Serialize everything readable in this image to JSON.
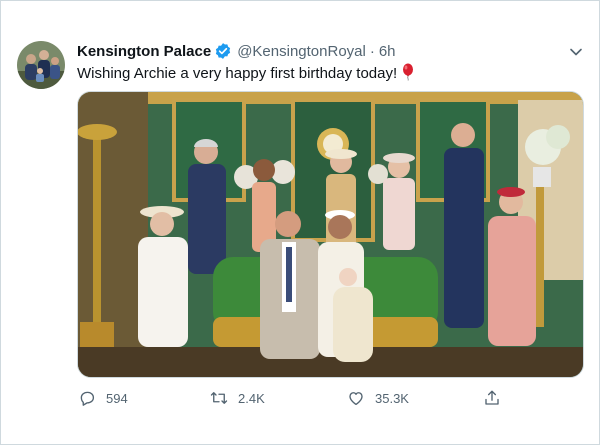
{
  "tweet": {
    "author_name": "Kensington Palace",
    "handle": "@KensingtonRoyal",
    "separator": "·",
    "time": "6h",
    "text": "Wishing Archie a very happy first birthday today!",
    "emoji": "balloon-icon"
  },
  "actions": {
    "replies": "594",
    "retweets": "2.4K",
    "likes": "35.3K"
  },
  "icons": {
    "verified": "verified-badge-icon",
    "more": "chevron-down-icon",
    "reply": "reply-icon",
    "retweet": "retweet-icon",
    "like": "heart-icon",
    "share": "share-icon"
  },
  "colors": {
    "verified_blue": "#1d9bf0",
    "secondary_text": "#536471",
    "primary_text": "#0f1419",
    "border": "#cfd9de"
  }
}
